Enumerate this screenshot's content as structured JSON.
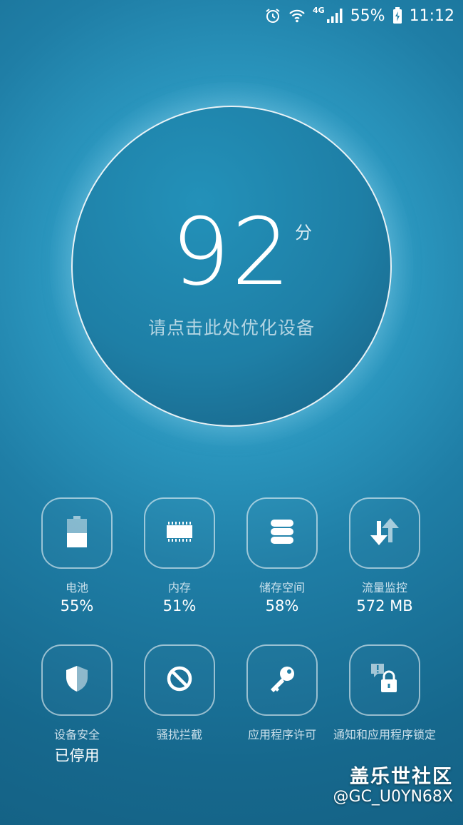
{
  "status_bar": {
    "battery_percent": "55%",
    "time": "11:12",
    "network": "4G",
    "icons": [
      "alarm-icon",
      "wifi-icon",
      "signal-icon",
      "battery-charging-icon"
    ]
  },
  "score": {
    "value": "92",
    "unit": "分",
    "hint": "请点击此处优化设备"
  },
  "tiles": [
    {
      "label": "电池",
      "value": "55%",
      "icon": "battery-icon"
    },
    {
      "label": "内存",
      "value": "51%",
      "icon": "memory-chip-icon"
    },
    {
      "label": "储存空间",
      "value": "58%",
      "icon": "storage-database-icon"
    },
    {
      "label": "流量监控",
      "value": "572 MB",
      "icon": "data-transfer-icon"
    },
    {
      "label": "设备安全",
      "value": "已停用",
      "icon": "shield-icon"
    },
    {
      "label": "骚扰拦截",
      "value": "",
      "icon": "block-icon"
    },
    {
      "label": "应用程序许可",
      "value": "",
      "icon": "key-icon"
    },
    {
      "label": "通知和应用程序锁定",
      "value": "",
      "icon": "notification-lock-icon"
    }
  ],
  "watermark": {
    "title": "盖乐世社区",
    "user": "@GC_U0YN68X"
  },
  "colors": {
    "background_top": "#2a95bd",
    "background_bottom": "#115676",
    "circle_fill": "#1e7fa6"
  }
}
